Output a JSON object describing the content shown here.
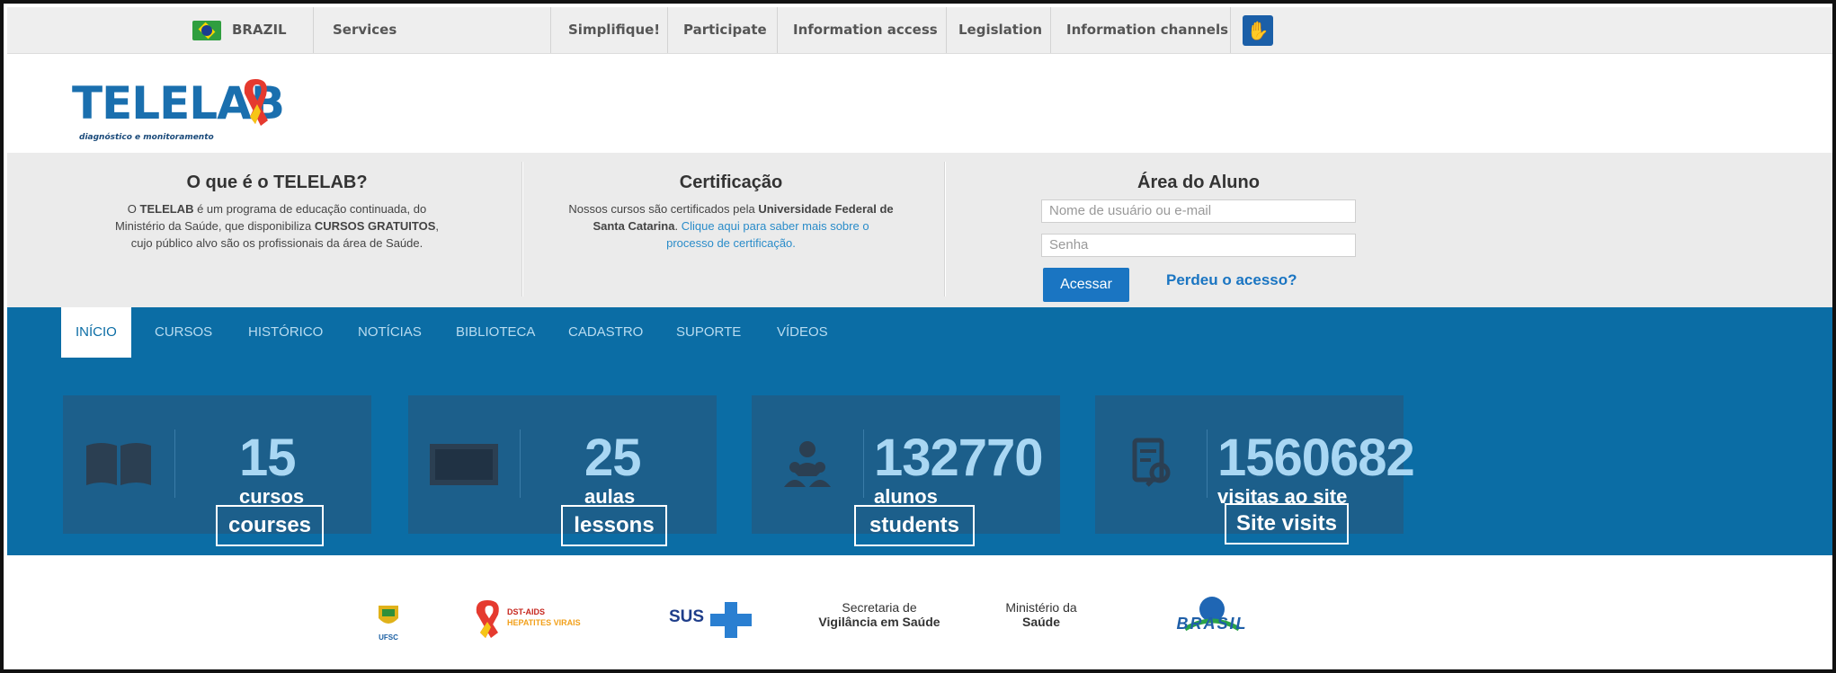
{
  "gov_bar": {
    "country": "BRAZIL",
    "links": [
      "Services",
      "Simplifique!",
      "Participate",
      "Information access",
      "Legislation",
      "Information channels"
    ]
  },
  "header": {
    "logo_title": "TELELAB",
    "logo_subtitle": "diagnóstico e monitoramento"
  },
  "info": {
    "about": {
      "title": "O que é o TELELAB?",
      "line1_a": "O ",
      "line1_b": "TELELAB",
      "line1_c": " é um programa de educação continuada, do",
      "line2_a": "Ministério da Saúde, que disponibiliza ",
      "line2_b": "CURSOS GRATUITOS",
      "line2_c": ",",
      "line3": "cujo público alvo são os profissionais da área de Saúde."
    },
    "cert": {
      "title": "Certificação",
      "line1_a": "Nossos cursos são certificados pela ",
      "line1_b": "Universidade Federal de",
      "line2_a": "Santa Catarina",
      "line2_b": ". ",
      "line2_c": "Clique aqui para saber mais sobre o",
      "line3": "processo de certificação."
    },
    "student": {
      "title": "Área do Aluno",
      "user_placeholder": "Nome de usuário ou e-mail",
      "pass_placeholder": "Senha",
      "login_button": "Acessar",
      "lost_link": "Perdeu o acesso?"
    }
  },
  "nav": [
    "INÍCIO",
    "CURSOS",
    "HISTÓRICO",
    "NOTÍCIAS",
    "BIBLIOTECA",
    "CADASTRO",
    "SUPORTE",
    "VÍDEOS"
  ],
  "stats": [
    {
      "value": "15",
      "label": "cursos",
      "tag": "courses"
    },
    {
      "value": "25",
      "label": "aulas",
      "tag": "lessons"
    },
    {
      "value": "132770",
      "label": "alunos",
      "tag": "students"
    },
    {
      "value": "1560682",
      "label": "visitas ao site",
      "tag": "Site visits"
    }
  ],
  "footer": {
    "ufsc": "UFSC",
    "dst_line1": "DST-AIDS",
    "dst_line2": "HEPATITES VIRAIS",
    "sus": "SUS",
    "svs_line1": "Secretaria de",
    "svs_line2": "Vigilância em Saúde",
    "ms_line1": "Ministério da",
    "ms_line2": "Saúde",
    "brasil": "BRASIL"
  }
}
